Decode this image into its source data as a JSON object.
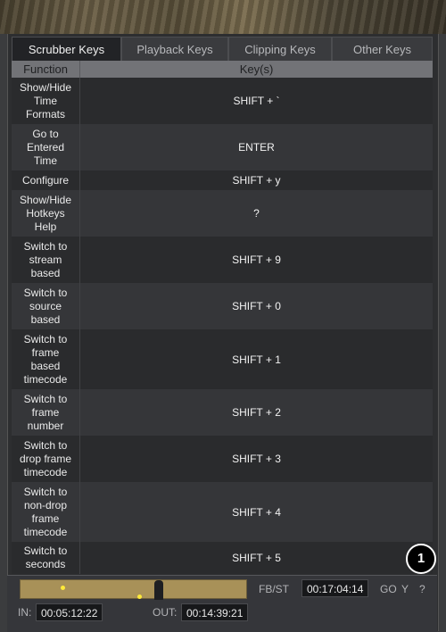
{
  "tabs": [
    {
      "label": "Scrubber Keys",
      "active": true
    },
    {
      "label": "Playback Keys",
      "active": false
    },
    {
      "label": "Clipping Keys",
      "active": false
    },
    {
      "label": "Other Keys",
      "active": false
    }
  ],
  "table": {
    "headers": {
      "function": "Function",
      "keys": "Key(s)"
    },
    "rows": [
      {
        "function": "Show/Hide\nTime\nFormats",
        "keys": "SHIFT + `"
      },
      {
        "function": "Go to\nEntered\nTime",
        "keys": "ENTER"
      },
      {
        "function": "Configure",
        "keys": "SHIFT + y"
      },
      {
        "function": "Show/Hide\nHotkeys\nHelp",
        "keys": "?"
      },
      {
        "function": "Switch to\nstream\nbased",
        "keys": "SHIFT + 9"
      },
      {
        "function": "Switch to\nsource\nbased",
        "keys": "SHIFT + 0"
      },
      {
        "function": "Switch to\nframe\nbased\ntimecode",
        "keys": "SHIFT + 1"
      },
      {
        "function": "Switch to\nframe\nnumber",
        "keys": "SHIFT + 2"
      },
      {
        "function": "Switch to\ndrop frame\ntimecode",
        "keys": "SHIFT + 3"
      },
      {
        "function": "Switch to\nnon-drop\nframe\ntimecode",
        "keys": "SHIFT + 4"
      },
      {
        "function": "Switch to\nseconds",
        "keys": "SHIFT + 5"
      }
    ]
  },
  "badge": "1",
  "controls": {
    "fbst_label": "FB/ST",
    "current_time": "00:17:04:14",
    "go_label": "GO",
    "y_label": "Y",
    "help_label": "?",
    "in_label": "IN:",
    "in_time": "00:05:12:22",
    "out_label": "OUT:",
    "out_time": "00:14:39:21"
  },
  "colors": {
    "scrubber_fill": "#a89158",
    "marker": "#ffea3a"
  }
}
